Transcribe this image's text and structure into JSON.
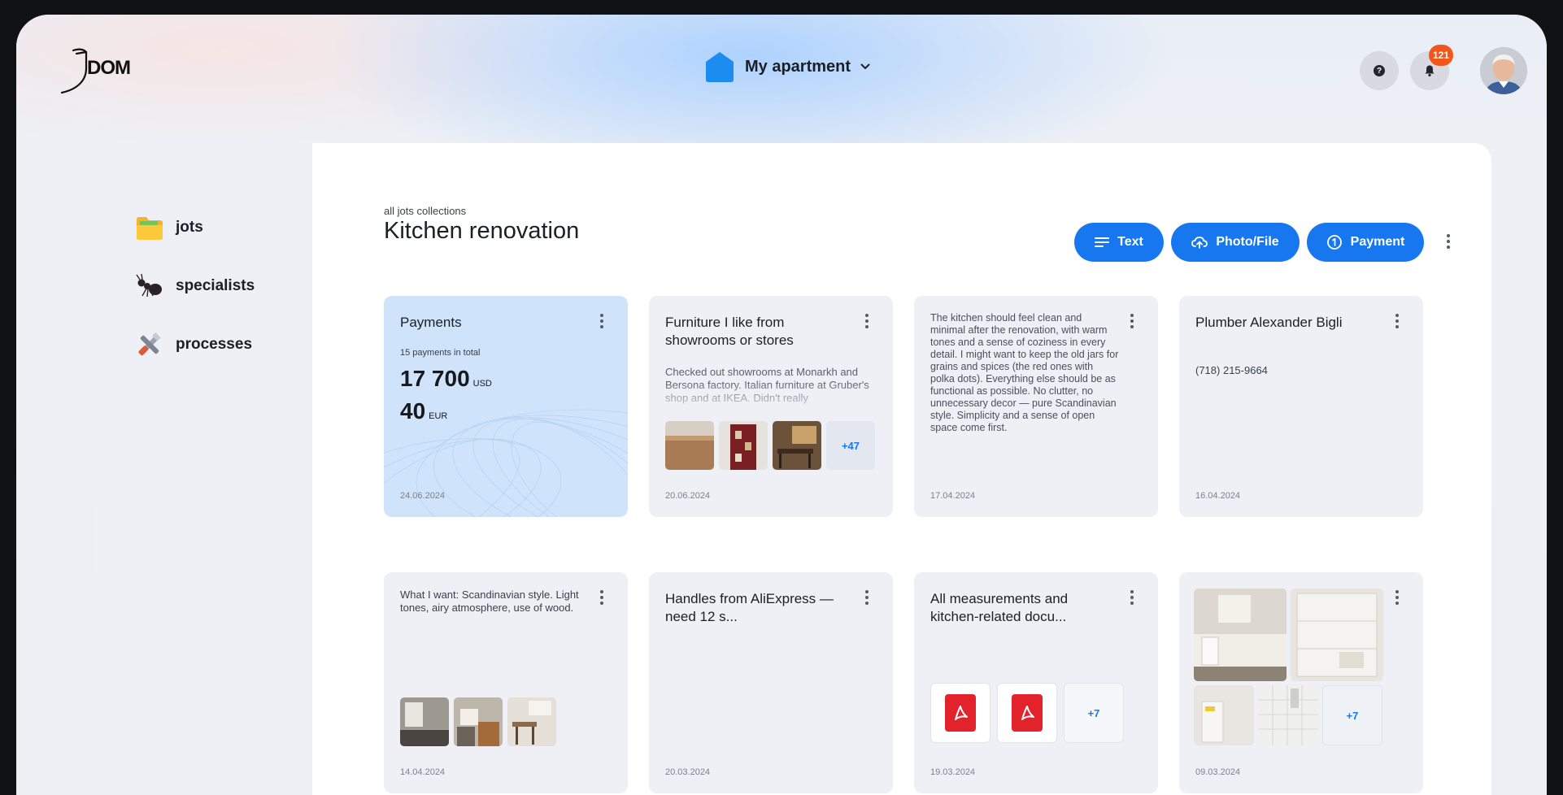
{
  "header": {
    "logo_text": "DOM",
    "apartment_label": "My apartment",
    "help_glyph": "?",
    "notifications_count": "121"
  },
  "sidebar": {
    "items": [
      {
        "label": "jots",
        "icon": "folder-icon"
      },
      {
        "label": "specialists",
        "icon": "ant-icon"
      },
      {
        "label": "processes",
        "icon": "tools-icon"
      }
    ]
  },
  "page": {
    "breadcrumb": "all jots collections",
    "title": "Kitchen renovation",
    "actions": {
      "text_label": "Text",
      "photo_label": "Photo/File",
      "payment_label": "Payment"
    }
  },
  "cards": [
    {
      "type": "payments",
      "title": "Payments",
      "subtitle": "15 payments in total",
      "amounts": [
        {
          "value": "17 700",
          "currency": "USD"
        },
        {
          "value": "40",
          "currency": "EUR"
        }
      ],
      "date": "24.06.2024"
    },
    {
      "type": "note-photos",
      "title": "Furniture I like from showrooms or stores",
      "body": "Checked out showrooms at Monarkh and Bersona factory. Italian furniture at Gruber's shop and at IKEA. Didn't really",
      "more_count": "+47",
      "date": "20.06.2024"
    },
    {
      "type": "text",
      "body": "The kitchen should feel clean and minimal after the renovation, with warm tones and a sense of coziness in every detail. I might want to keep the old jars for grains and spices (the red ones with polka dots). Everything else should be as functional as possible. No clutter, no unnecessary decor — pure Scandinavian style. Simplicity and a sense of open space come first.",
      "date": "17.04.2024"
    },
    {
      "type": "contact",
      "title": "Plumber Alexander Bigli",
      "phone": "(718) 215-9664",
      "date": "16.04.2024"
    },
    {
      "type": "text-photos",
      "body": "What I want: Scandinavian style. Light tones, airy atmosphere, use of wood.",
      "date": "14.04.2024"
    },
    {
      "type": "note",
      "title": "Handles from AliExpress — need 12 s...",
      "date": "20.03.2024"
    },
    {
      "type": "files",
      "title": "All measurements and kitchen-related docu...",
      "more_count": "+7",
      "date": "19.03.2024"
    },
    {
      "type": "photos",
      "more_count": "+7",
      "date": "09.03.2024"
    }
  ],
  "colors": {
    "accent": "#1777ef",
    "badge": "#f2561d",
    "payments_card": "#cfe3fb",
    "card_bg": "#eef0f6"
  }
}
